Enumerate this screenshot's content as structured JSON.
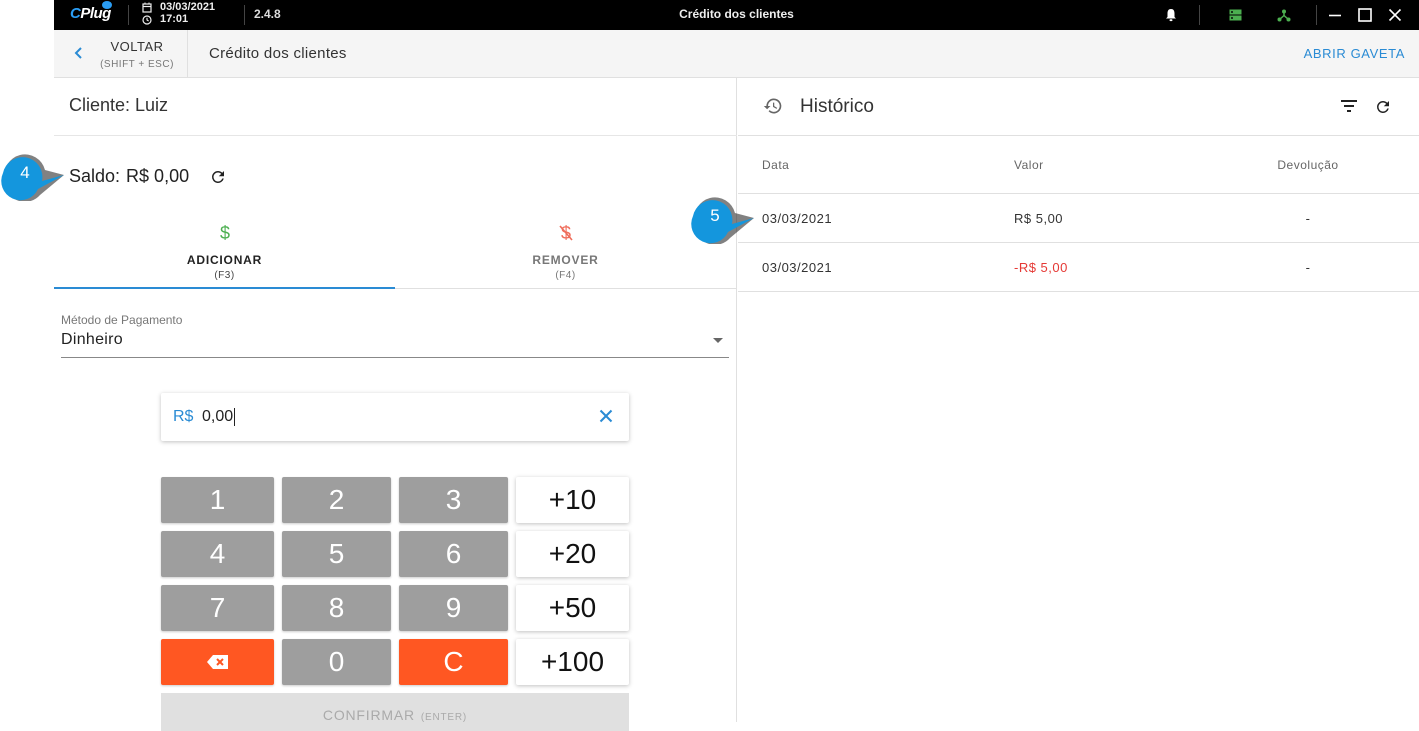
{
  "titlebar": {
    "logo": "CPlug",
    "date": "03/03/2021",
    "time": "17:01",
    "version": "2.4.8",
    "title": "Crédito dos clientes",
    "colors": {
      "bg": "#000000",
      "accent": "#2a9df4",
      "green": "#4caf50"
    }
  },
  "header": {
    "back_label": "VOLTAR",
    "back_hint": "(SHIFT + ESC)",
    "title": "Crédito dos clientes",
    "drawer_button": "ABRIR GAVETA"
  },
  "client": {
    "label": "Cliente: Luiz",
    "balance_label": "Saldo:",
    "balance_value": "R$ 0,00"
  },
  "tabs": [
    {
      "label": "ADICIONAR",
      "key": "(F3)",
      "icon": "dollar-icon",
      "color": "#4caf50",
      "active": true
    },
    {
      "label": "REMOVER",
      "key": "(F4)",
      "icon": "dollar-off-icon",
      "color": "#ef6c5a",
      "active": false
    }
  ],
  "payment": {
    "label": "Método de Pagamento",
    "value": "Dinheiro"
  },
  "amount": {
    "currency": "R$",
    "value": "0,00"
  },
  "keypad": {
    "digits": [
      "1",
      "2",
      "3",
      "4",
      "5",
      "6",
      "7",
      "8",
      "9",
      "0"
    ],
    "plus": [
      "+10",
      "+20",
      "+50",
      "+100"
    ],
    "clear": "C",
    "confirm": "CONFIRMAR",
    "confirm_key": "(ENTER)",
    "colors": {
      "digit": "#9e9e9e",
      "action": "#ff5722"
    }
  },
  "history": {
    "title": "Histórico",
    "columns": [
      "Data",
      "Valor",
      "Devolução"
    ],
    "rows": [
      {
        "date": "03/03/2021",
        "value": "R$ 5,00",
        "refund": "-"
      },
      {
        "date": "03/03/2021",
        "value": "-R$ 5,00",
        "refund": "-"
      }
    ]
  },
  "callouts": [
    "4",
    "5"
  ]
}
